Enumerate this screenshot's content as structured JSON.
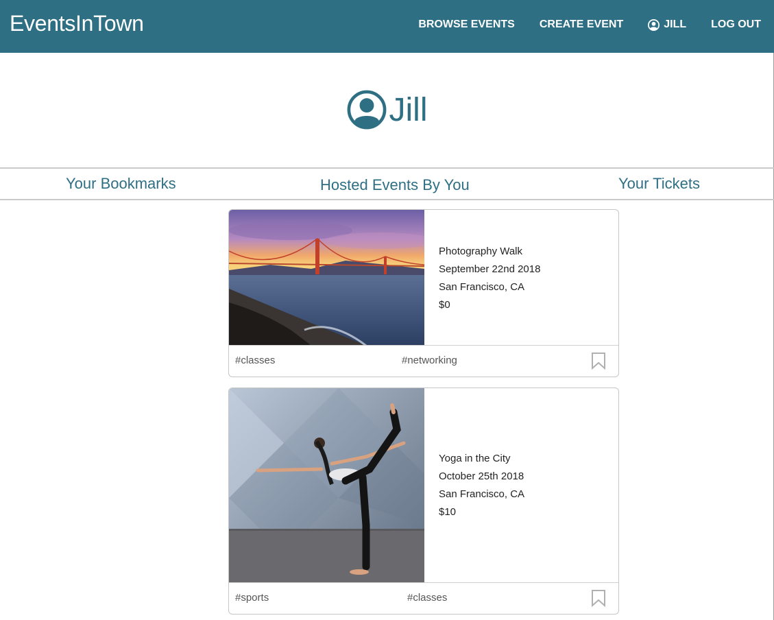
{
  "nav": {
    "brand": "EventsInTown",
    "links": [
      {
        "label": "BROWSE EVENTS"
      },
      {
        "label": "CREATE EVENT"
      },
      {
        "label": "JILL",
        "icon": "user-circle-icon"
      },
      {
        "label": "LOG OUT"
      }
    ]
  },
  "profile": {
    "name": "Jill",
    "icon": "user-circle-icon"
  },
  "tabs": [
    {
      "label": "Your Bookmarks"
    },
    {
      "label": "Hosted Events By You",
      "active": true
    },
    {
      "label": "Your Tickets"
    }
  ],
  "events": [
    {
      "title": "Photography Walk",
      "date": "September 22nd 2018",
      "location": "San Francisco, CA",
      "price": "$0",
      "tags": [
        "#classes",
        "#networking"
      ],
      "image": "golden-gate-bridge-sunset-photo"
    },
    {
      "title": "Yoga in the City",
      "date": "October 25th 2018",
      "location": "San Francisco, CA",
      "price": "$10",
      "tags": [
        "#sports",
        "#classes"
      ],
      "image": "yoga-pose-photo"
    }
  ],
  "colors": {
    "primary": "#2f6f84",
    "white": "#ffffff",
    "border": "#c6c6c6"
  }
}
